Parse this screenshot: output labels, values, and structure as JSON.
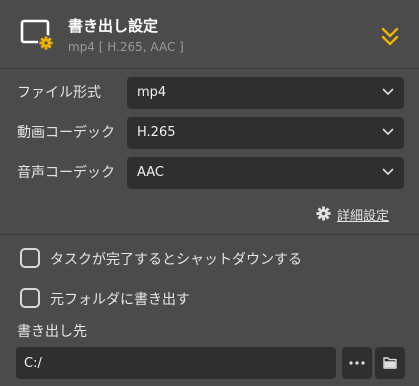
{
  "header": {
    "title": "書き出し設定",
    "subtitle": "mp4 [ H.265, AAC ]",
    "icon": "monitor-gear-icon",
    "collapse_icon": "double-chevron-down-icon",
    "accent_color": "#f0b400"
  },
  "form": {
    "file_format": {
      "label": "ファイル形式",
      "value": "mp4"
    },
    "video_codec": {
      "label": "動画コーデック",
      "value": "H.265"
    },
    "audio_codec": {
      "label": "音声コーデック",
      "value": "AAC"
    }
  },
  "advanced": {
    "label": "詳細設定",
    "icon": "gear-icon"
  },
  "options": [
    {
      "label": "タスクが完了するとシャットダウンする",
      "checked": false
    },
    {
      "label": "元フォルダに書き出す",
      "checked": false
    }
  ],
  "destination": {
    "label": "書き出し先",
    "path": "C:/",
    "more_icon": "ellipsis-icon",
    "folder_icon": "folder-icon"
  }
}
